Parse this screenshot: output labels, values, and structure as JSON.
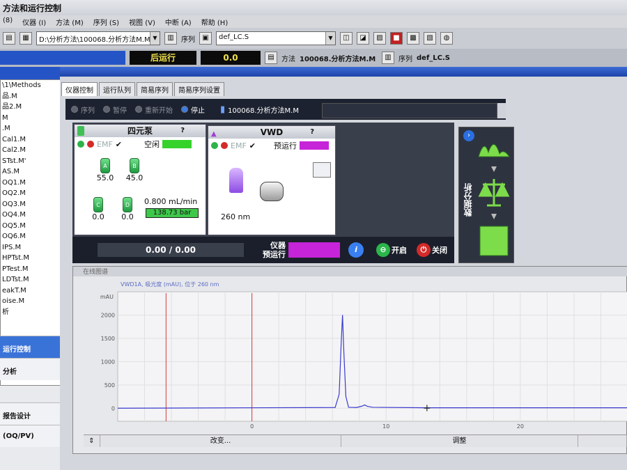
{
  "window": {
    "title": "方法和运行控制"
  },
  "menu": [
    "(8)",
    "仪器 (I)",
    "方法 (M)",
    "序列 (S)",
    "视图 (V)",
    "中断 (A)",
    "帮助 (H)"
  ],
  "toolbar": {
    "method_path": "D:\\分析方法\\100068.分析方法M.M",
    "sequence_label": "序列",
    "sequence_value": "def_LC.S"
  },
  "statusbar": {
    "run_state": "后运行",
    "run_value": "0.0",
    "method_label": "方法",
    "method_name": "100068.分析方法M.M",
    "sequence_label": "序列",
    "sequence_name": "def_LC.S"
  },
  "left_list": {
    "items": [
      "\\1\\Methods",
      "",
      "品.M",
      "品2.M",
      "M",
      ".M",
      "Cal1.M",
      "Cal2.M",
      "STst.M'",
      "AS.M",
      "OQ1.M",
      "OQ2.M",
      "OQ3.M",
      "OQ4.M",
      "OQ5.M",
      "OQ6.M",
      "IPS.M",
      "HPTst.M",
      "PTest.M",
      "LDTst.M",
      "eakT.M",
      "oise.M"
    ],
    "footer": "析"
  },
  "left_nav": [
    "运行控制",
    "分析",
    "报告设计",
    "(OQ/PV)"
  ],
  "tabs": [
    "仪器控制",
    "运行队列",
    "简易序列",
    "简易序列设置"
  ],
  "ctrl": {
    "buttons": [
      "序列",
      "暂停",
      "重新开始",
      "停止"
    ],
    "method": "100068.分析方法M.M"
  },
  "pump": {
    "title": "四元泵",
    "help": "?",
    "emf": "EMF",
    "state": "空闲",
    "state_color": "#35d22b",
    "solvents": [
      {
        "letter": "A",
        "value": "55.0"
      },
      {
        "letter": "B",
        "value": "45.0"
      },
      {
        "letter": "C",
        "value": "0.0"
      },
      {
        "letter": "D",
        "value": "0.0"
      }
    ],
    "flow": "0.800 mL/min",
    "pressure": "138.73 bar"
  },
  "vwd": {
    "title": "VWD",
    "help": "?",
    "emf": "EMF",
    "state": "预运行",
    "state_color": "#c624d8",
    "wavelength": "260 nm"
  },
  "bottombar": {
    "progress": "0.00 / 0.00",
    "inst_label_1": "仪器",
    "inst_label_2": "预运行",
    "inst_color": "#c624d8",
    "on_label": "开启",
    "off_label": "关闭"
  },
  "data_analysis": {
    "label": "数据分析"
  },
  "chart_panel": {
    "header": "在线图谱",
    "bottom_left": "改变...",
    "bottom_right": "调整"
  },
  "chart_data": {
    "type": "line",
    "title": "VWD1A, 吸光度 (mAU), 位于 260 nm",
    "ylabel": "mAU",
    "xlabel": "",
    "xlim": [
      -10,
      28
    ],
    "ylim": [
      -280,
      2500
    ],
    "xticks": [
      0,
      10,
      20
    ],
    "yticks": [
      0,
      500,
      1000,
      1500,
      2000
    ],
    "markers_x": [
      -6.4,
      0
    ],
    "series": [
      {
        "x": [
          -10,
          6.2,
          6.5,
          6.65,
          6.75,
          6.85,
          7.0,
          7.2,
          7.8,
          8.2,
          8.4,
          8.6,
          9.0,
          13,
          20,
          28
        ],
        "values": [
          0,
          15,
          300,
          1400,
          2000,
          1200,
          250,
          20,
          15,
          45,
          70,
          40,
          20,
          10,
          10,
          10
        ]
      }
    ]
  }
}
